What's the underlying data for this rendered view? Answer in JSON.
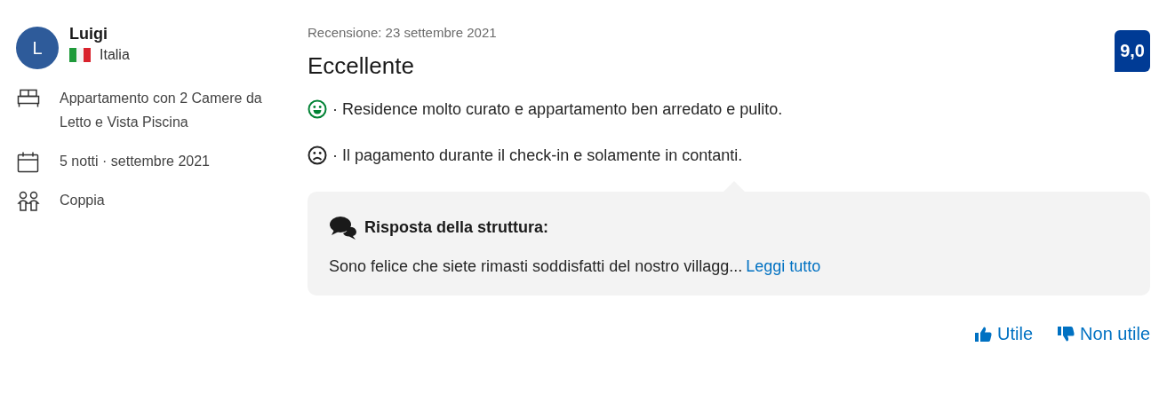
{
  "reviewer": {
    "initial": "L",
    "name": "Luigi",
    "country": "Italia"
  },
  "details": [
    {
      "kind": "room",
      "text": "Appartamento con 2 Camere da Letto e Vista Piscina"
    },
    {
      "kind": "stay",
      "text": "5 notti ·  settembre 2021"
    },
    {
      "kind": "group",
      "text": "Coppia"
    }
  ],
  "review": {
    "date": "Recensione: 23 settembre 2021",
    "title": "Eccellente",
    "score": "9,0",
    "comments": [
      {
        "kind": "positive",
        "text": "· Residence molto curato e appartamento ben arredato e pulito."
      },
      {
        "kind": "negative",
        "text": "· Il pagamento durante il check-in e solamente in contanti."
      }
    ]
  },
  "response": {
    "title": "Risposta della struttura:",
    "text": "Sono felice che siete rimasti soddisfatti del nostro villagg...",
    "link": "Leggi tutto"
  },
  "votes": [
    {
      "kind": "up",
      "label": "Utile"
    },
    {
      "kind": "down",
      "label": "Non utile"
    }
  ]
}
